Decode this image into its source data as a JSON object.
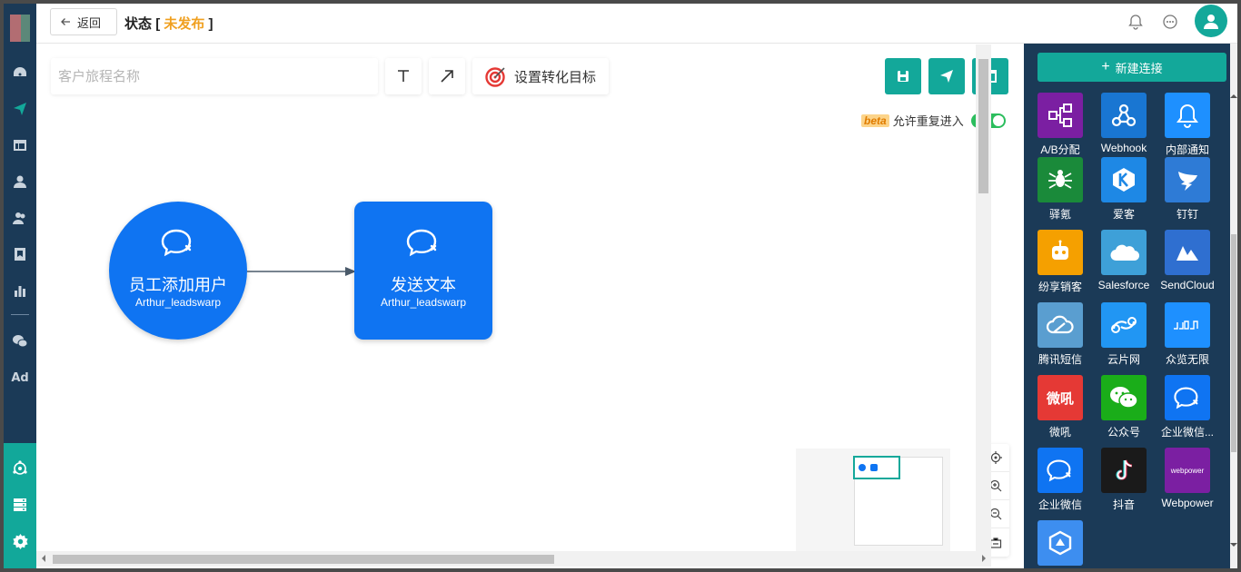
{
  "header": {
    "back_label": "返回",
    "status_label": "状态",
    "bracket_open": "[",
    "status_value": "未发布",
    "bracket_close": "]",
    "status_color": "#f0a020"
  },
  "toolbar": {
    "journey_name_placeholder": "客户旅程名称",
    "text_tool_icon": "text-icon",
    "arrow_tool_icon": "arrow-icon",
    "goal_label": "设置转化目标",
    "save_icon": "save-icon",
    "publish_icon": "send-icon",
    "layout_icon": "layout-icon"
  },
  "reentry": {
    "beta": "beta",
    "label": "允许重复进入",
    "enabled": true
  },
  "nodes": [
    {
      "title": "员工添加用户",
      "subtitle": "Arthur_leadswarp",
      "shape": "circle",
      "icon": "wecom-icon"
    },
    {
      "title": "发送文本",
      "subtitle": "Arthur_leadswarp",
      "shape": "rounded-rect",
      "icon": "wecom-icon"
    }
  ],
  "right_panel": {
    "new_connection_label": "新建连接",
    "connectors": [
      {
        "label": "A/B分配",
        "color": "#7b1fa2"
      },
      {
        "label": "Webhook",
        "color": "#1976d2"
      },
      {
        "label": "内部通知",
        "color": "#1e90ff"
      },
      {
        "label": "驿氪",
        "color": "#1a8a3a"
      },
      {
        "label": "爱客",
        "color": "#1e88e5"
      },
      {
        "label": "钉钉",
        "color": "#2e7bd6"
      },
      {
        "label": "纷享销客",
        "color": "#f5a000"
      },
      {
        "label": "Salesforce",
        "color": "#3ea0d8"
      },
      {
        "label": "SendCloud",
        "color": "#2f6fd0"
      },
      {
        "label": "腾讯短信",
        "color": "#5a9ed0"
      },
      {
        "label": "云片网",
        "color": "#2196f3"
      },
      {
        "label": "众览无限",
        "color": "#1e90ff"
      },
      {
        "label": "微吼",
        "color": "#e53935"
      },
      {
        "label": "公众号",
        "color": "#1aad19"
      },
      {
        "label": "企业微信...",
        "color": "#0f74f2"
      },
      {
        "label": "企业微信",
        "color": "#0f74f2"
      },
      {
        "label": "抖音",
        "color": "#1a1a1a"
      },
      {
        "label": "Webpower",
        "color": "#7b1fa2"
      },
      {
        "label": "",
        "color": "#3d8ef0"
      }
    ],
    "tile_texts": {
      "weihou": "微吼",
      "zhonglan": "微",
      "webpower": "webpower",
      "sendcloud_text": ""
    }
  },
  "sidebar": {
    "ad_label": "Ad"
  }
}
